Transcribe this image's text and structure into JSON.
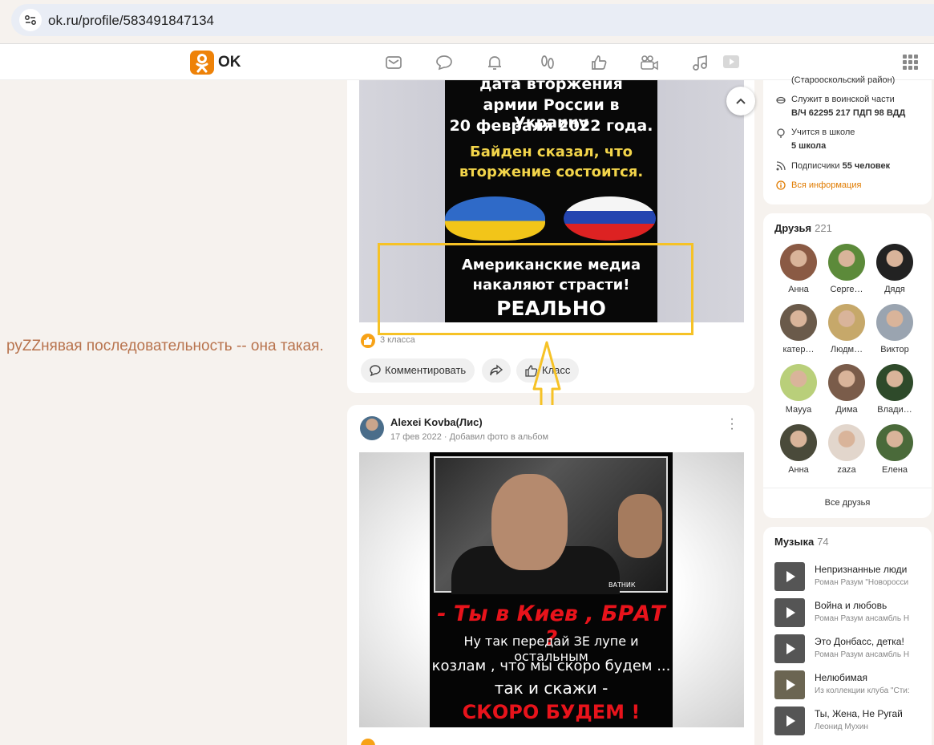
{
  "browser": {
    "url": "ok.ru/profile/583491847134"
  },
  "header": {
    "logo_text": "OK",
    "brand_color": "#ee8208"
  },
  "nav_icons": [
    "mail-icon",
    "chat-icon",
    "bell-icon",
    "guests-icon",
    "like-icon",
    "video-icon",
    "music-icon",
    "play-icon"
  ],
  "left_text": "руZZнявая последовательность -- она такая.",
  "post1": {
    "poster_lines": [
      "дата вторжения",
      "армии России в Украину",
      "20 февраля 2022 года.",
      "Байден сказал, что",
      "вторжение состоится.",
      "Американские медиа",
      "накаляют страсти!",
      "РЕАЛЬНО"
    ],
    "likes": "3 класса",
    "comment_label": "Комментировать",
    "class_label": "Класс"
  },
  "post2": {
    "author": "Alexei Kovba(Лис)",
    "date": "17 фев 2022 · Добавил фото в альбом",
    "poster_lines": [
      "ВАТНИК",
      "- Ты в Киев , БРАТ ?",
      "Ну так передай ЗЕ лупе и остальным",
      "козлам , что мы скоро будем ...",
      "так и скажи -",
      "СКОРО  БУДЕМ !"
    ]
  },
  "sidebar_info": {
    "region": "(Старооскольский район)",
    "military_label": "Служит в воинской части",
    "military_value": "В/Ч 62295 217 ПДП 98 ВДД",
    "school_label": "Учится в школе",
    "school_value": "5 школа",
    "followers_label": "Подписчики",
    "followers_value": "55 человек",
    "all_info": "Вся информация"
  },
  "friends": {
    "title": "Друзья",
    "count": "221",
    "items": [
      {
        "name": "Анна",
        "color": "#8a5a44"
      },
      {
        "name": "Серге…",
        "color": "#5c8a3a"
      },
      {
        "name": "Дядя",
        "color": "#222222"
      },
      {
        "name": "катер…",
        "color": "#6a5a4a"
      },
      {
        "name": "Людм…",
        "color": "#c6a86a"
      },
      {
        "name": "Виктор",
        "color": "#9aa4b0"
      },
      {
        "name": "Мayya",
        "color": "#b9cf7a"
      },
      {
        "name": "Дима",
        "color": "#7a5c4a"
      },
      {
        "name": "Влади…",
        "color": "#2e4a2a"
      },
      {
        "name": "Анна",
        "color": "#4a4a3a"
      },
      {
        "name": "zaza",
        "color": "#e2d6cc"
      },
      {
        "name": "Елена",
        "color": "#4a6a3a"
      }
    ],
    "all_label": "Все друзья"
  },
  "music": {
    "title": "Музыка",
    "count": "74",
    "tracks": [
      {
        "title": "Непризнанные люди",
        "artist": "Роман Разум \"Новоросси"
      },
      {
        "title": "Война и любовь",
        "artist": "Роман Разум ансамбль Н"
      },
      {
        "title": "Это Донбасс, детка!",
        "artist": "Роман Разум ансамбль Н"
      },
      {
        "title": "Нелюбимая",
        "artist": "Из коллекции клуба \"Сти:"
      },
      {
        "title": "Ты, Жена, Не Ругай",
        "artist": "Леонид Мухин"
      }
    ]
  }
}
